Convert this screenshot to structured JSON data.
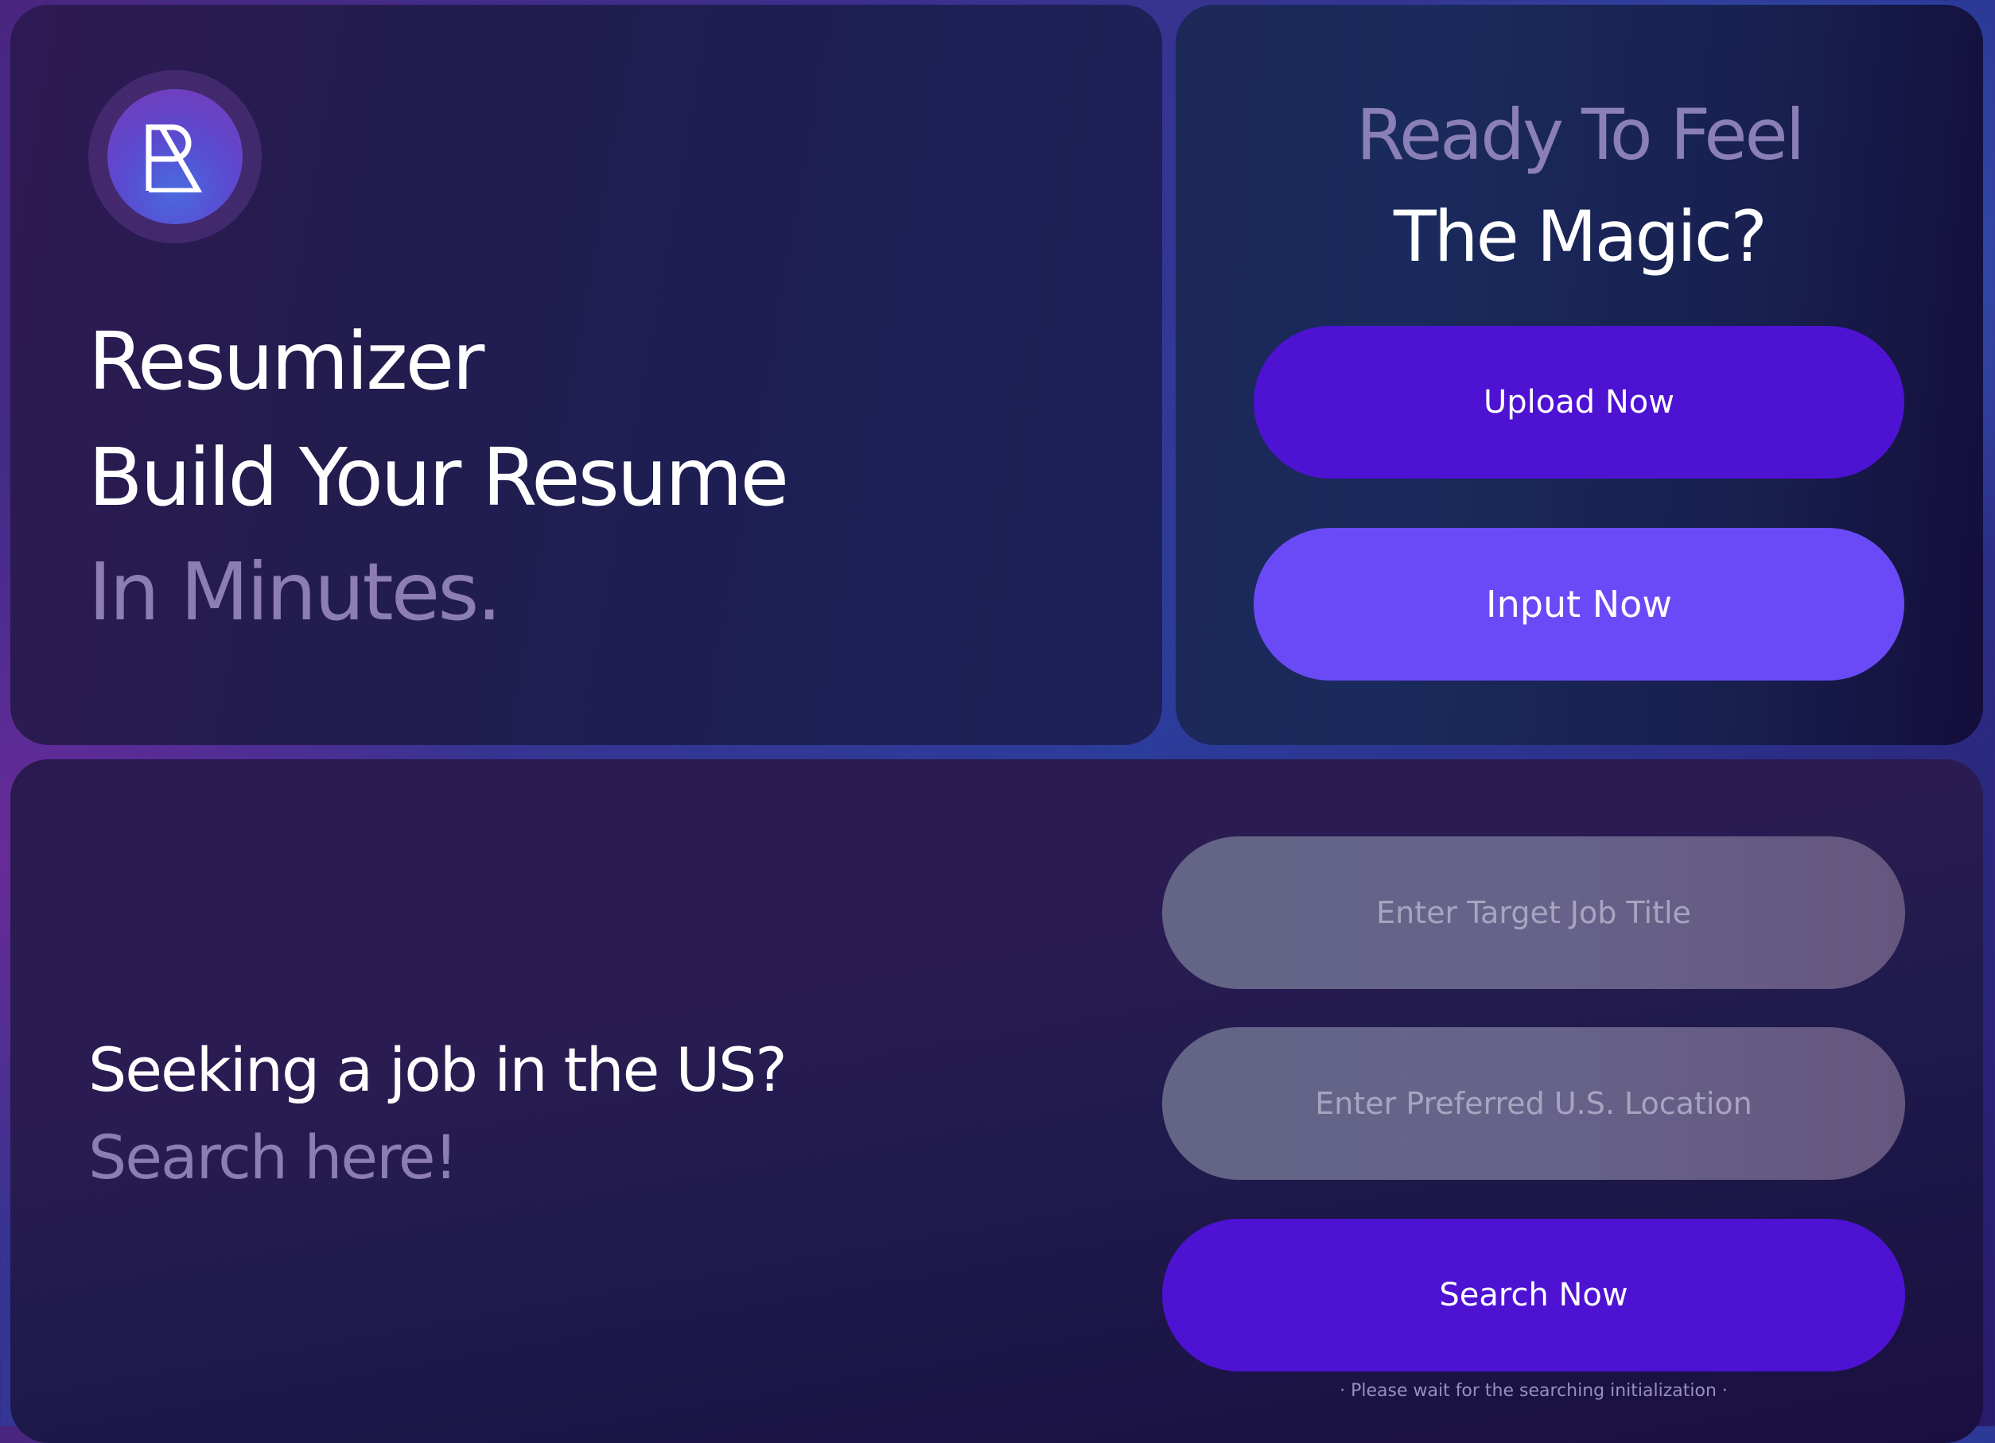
{
  "hero": {
    "logo_icon": "resumizer-logo-icon",
    "line1": "Resumizer",
    "line2": "Build Your Resume",
    "line3": "In Minutes."
  },
  "cta": {
    "title_line1": "Ready To Feel",
    "title_line2": "The Magic?",
    "upload_label": "Upload Now",
    "input_label": "Input Now"
  },
  "search": {
    "heading": "Seeking a job in the US?",
    "subheading": "Search here!",
    "job_title_placeholder": "Enter Target Job Title",
    "location_placeholder": "Enter Preferred U.S. Location",
    "search_label": "Search Now",
    "note": "· Please wait for the searching initialization ·"
  },
  "colors": {
    "primary_button": "#4e12d3",
    "secondary_button": "#6a4af6",
    "muted_text": "#8c7db4",
    "input_fill": "#636486"
  }
}
